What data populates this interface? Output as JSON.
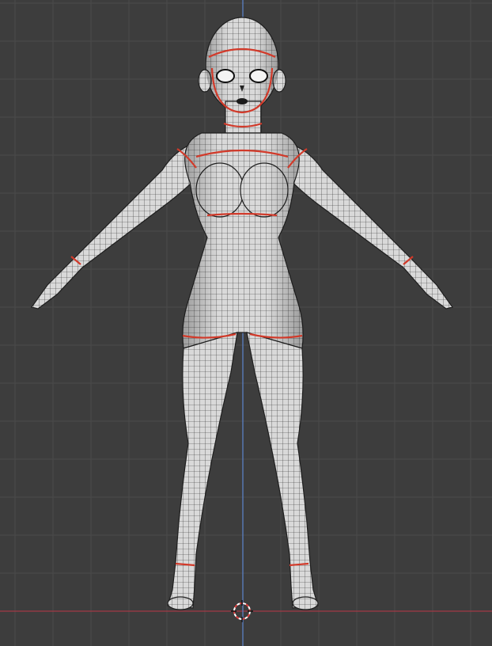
{
  "viewport": {
    "view": "front-orthographic",
    "background_color": "#3d3d3d",
    "grid_color": "#4a4a4a",
    "axis_x_color": "#a33a45",
    "axis_z_color": "#5a7fc4"
  },
  "model": {
    "pose": "A-pose",
    "display": "wireframe-over-solid",
    "surface_color": "#d9d9d9",
    "wire_color": "#1f1f1f",
    "seam_color": "#d23a2a",
    "seam_loops": [
      "head-cap",
      "face-outline",
      "neck",
      "shoulder-left",
      "shoulder-right",
      "chest-under",
      "wrist-left",
      "wrist-right",
      "upper-thigh-left",
      "upper-thigh-right",
      "ankle-left",
      "ankle-right"
    ]
  },
  "cursor_3d": {
    "name": "3d-cursor",
    "color_a": "#e04040",
    "color_b": "#ffffff"
  }
}
